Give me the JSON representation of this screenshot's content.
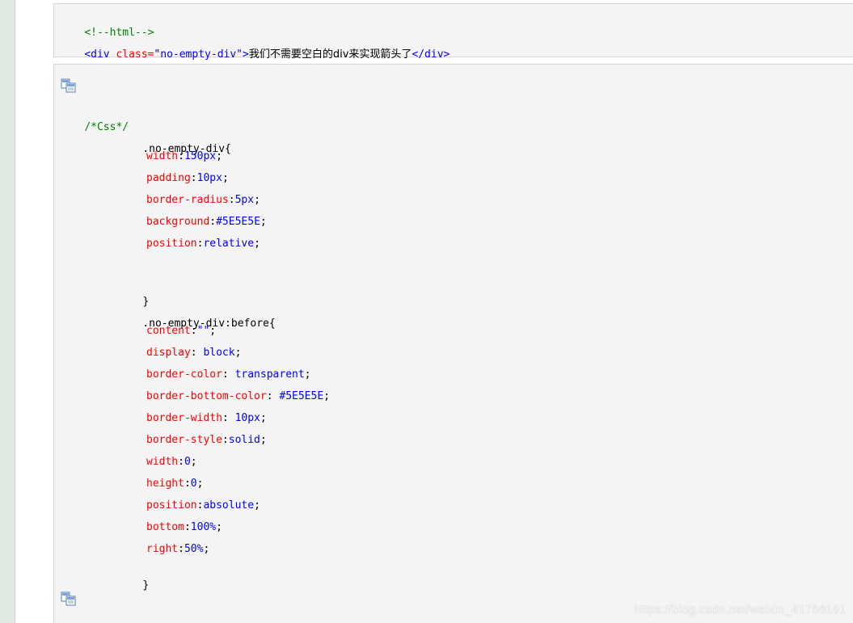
{
  "html_block": {
    "comment": "<!--html-->",
    "line2": {
      "tag_open": "<div",
      "attr": "class=",
      "attr_value": "\"no-empty-div\"",
      "tag_close": ">",
      "text": "我们不需要空白的div来实现箭头了",
      "end_tag": "</div>"
    }
  },
  "css_block": {
    "copy_icon": "copy-icon",
    "comment": "/*Css*/",
    "rule1": {
      "selector": ".no-empty-div{",
      "declarations": [
        {
          "prop": "width",
          "sep": ":",
          "value": "150px",
          "end": ";"
        },
        {
          "prop": "padding",
          "sep": ":",
          "value": "10px",
          "end": ";"
        },
        {
          "prop": "border-radius",
          "sep": ":",
          "value": "5px",
          "end": ";"
        },
        {
          "prop": "background",
          "sep": ":",
          "value": "#5E5E5E",
          "end": ";"
        },
        {
          "prop": "position",
          "sep": ":",
          "value": "relative",
          "end": ";"
        }
      ],
      "close": "}"
    },
    "rule2": {
      "selector": ".no-empty-div:before{",
      "declarations": [
        {
          "prop": "content",
          "sep": ":",
          "value": "\"\"",
          "end": ";"
        },
        {
          "prop": "display",
          "sep": ": ",
          "value": "block",
          "end": ";"
        },
        {
          "prop": "border-color",
          "sep": ": ",
          "value": "transparent",
          "end": ";"
        },
        {
          "prop": "border-bottom-color",
          "sep": ": ",
          "value": "#5E5E5E",
          "end": ";"
        },
        {
          "prop": "border-width",
          "sep": ": ",
          "value": "10px",
          "end": ";"
        },
        {
          "prop": "border-style",
          "sep": ":",
          "value": "solid",
          "end": ";"
        },
        {
          "prop": "width",
          "sep": ":",
          "value": "0",
          "end": ";"
        },
        {
          "prop": "height",
          "sep": ":",
          "value": "0",
          "end": ";"
        },
        {
          "prop": "position",
          "sep": ":",
          "value": "absolute",
          "end": ";"
        },
        {
          "prop": "bottom",
          "sep": ":",
          "value": "100%",
          "end": ";"
        },
        {
          "prop": "right",
          "sep": ":",
          "value": "50%",
          "end": ";"
        }
      ],
      "close": "}"
    }
  },
  "watermark": "https://blog.csdn.net/weixin_41766191",
  "colors": {
    "comment": "#008000",
    "tag": "#0000ff",
    "attr": "#ff0000",
    "value": "#0000ff",
    "property": "#ff0000",
    "block_bg": "#f4f4f4",
    "gutter_bg": "#dfe9df"
  }
}
